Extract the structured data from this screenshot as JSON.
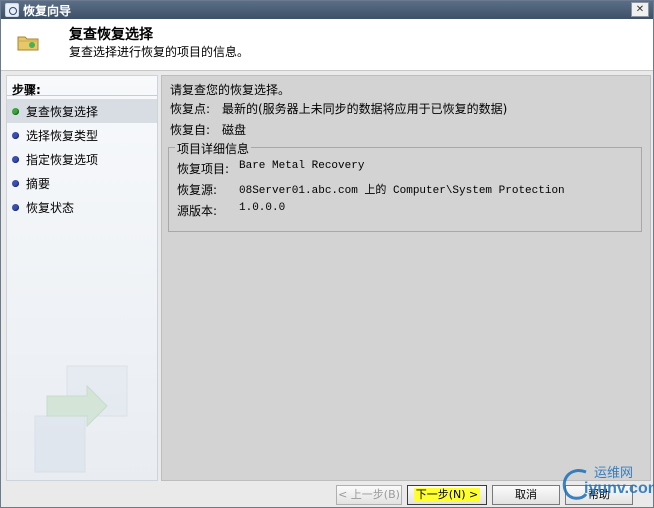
{
  "window": {
    "title": "恢复向导",
    "close_glyph": "✕"
  },
  "header": {
    "title": "复查恢复选择",
    "subtitle": "复查选择进行恢复的项目的信息。"
  },
  "sidebar": {
    "heading": "步骤:",
    "items": [
      {
        "label": "复查恢复选择",
        "active": true
      },
      {
        "label": "选择恢复类型",
        "active": false
      },
      {
        "label": "指定恢复选项",
        "active": false
      },
      {
        "label": "摘要",
        "active": false
      },
      {
        "label": "恢复状态",
        "active": false
      }
    ]
  },
  "content": {
    "intro": "请复查您的恢复选择。",
    "recovery_point_label": "恢复点:",
    "recovery_point_value": "最新的(服务器上未同步的数据将应用于已恢复的数据)",
    "recovery_from_label": "恢复自:",
    "recovery_from_value": "磁盘",
    "details": {
      "legend": "项目详细信息",
      "item_label": "恢复项目:",
      "item_value": "Bare Metal Recovery",
      "source_label": "恢复源:",
      "source_value": "08Server01.abc.com 上的 Computer\\System Protection",
      "version_label": "源版本:",
      "version_value": "1.0.0.0"
    }
  },
  "footer": {
    "back": "< 上一步(B)",
    "next": "下一步(N) >",
    "cancel": "取消",
    "help": "帮助"
  },
  "watermark": {
    "name": "运维网",
    "domain": "iyunv.com"
  },
  "colors": {
    "highlight": "#ffff30",
    "bullet_active": "#3ca63c",
    "bullet": "#3a4fb0"
  }
}
